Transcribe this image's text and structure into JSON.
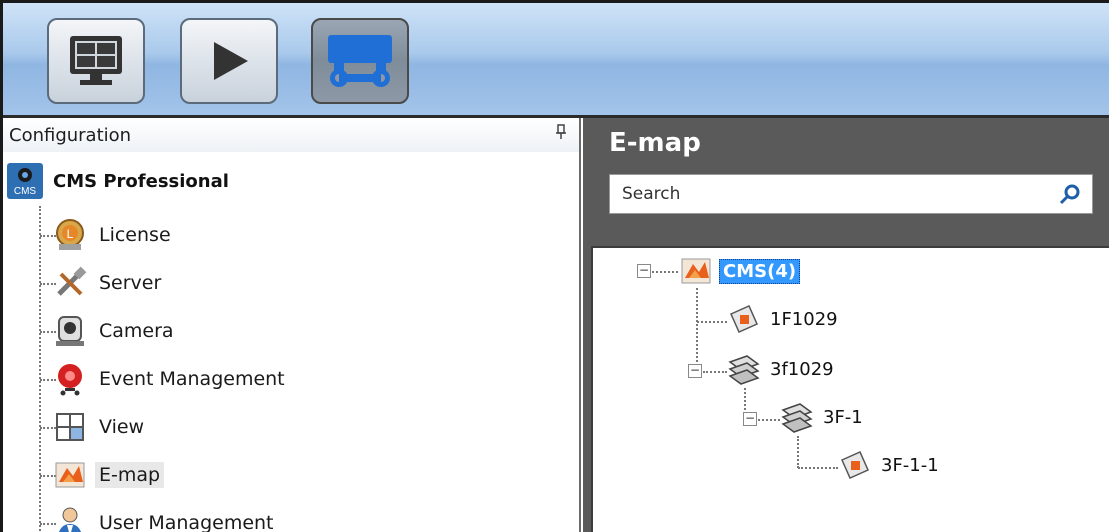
{
  "toolbar": {
    "buttons": [
      {
        "icon": "monitor-icon",
        "active": false
      },
      {
        "icon": "play-icon",
        "active": false
      },
      {
        "icon": "config-icon",
        "active": true
      }
    ]
  },
  "left_panel": {
    "header": "Configuration",
    "pin_glyph": "ꟸ",
    "root": {
      "icon_text": "CMS",
      "label": "CMS Professional"
    },
    "items": [
      {
        "label": "License",
        "icon": "license-icon"
      },
      {
        "label": "Server",
        "icon": "server-tools-icon"
      },
      {
        "label": "Camera",
        "icon": "camera-icon"
      },
      {
        "label": "Event Management",
        "icon": "event-alarm-icon"
      },
      {
        "label": "View",
        "icon": "view-grid-icon"
      },
      {
        "label": "E-map",
        "icon": "emap-icon",
        "selected": true
      },
      {
        "label": "User Management",
        "icon": "user-icon"
      }
    ]
  },
  "right_panel": {
    "title": "E-map",
    "search": {
      "placeholder": "Search"
    },
    "tree": {
      "root": {
        "label": "CMS(4)",
        "expander": "−"
      },
      "n1": {
        "label": "1F1029"
      },
      "n2": {
        "label": "3f1029",
        "expander": "−"
      },
      "n3": {
        "label": "3F-1",
        "expander": "−"
      },
      "n4": {
        "label": "3F-1-1"
      }
    }
  },
  "colors": {
    "toolbar_blue": "#a9c9ec",
    "panel_gray": "#5a5a5a",
    "selection_blue": "#3399ff"
  }
}
